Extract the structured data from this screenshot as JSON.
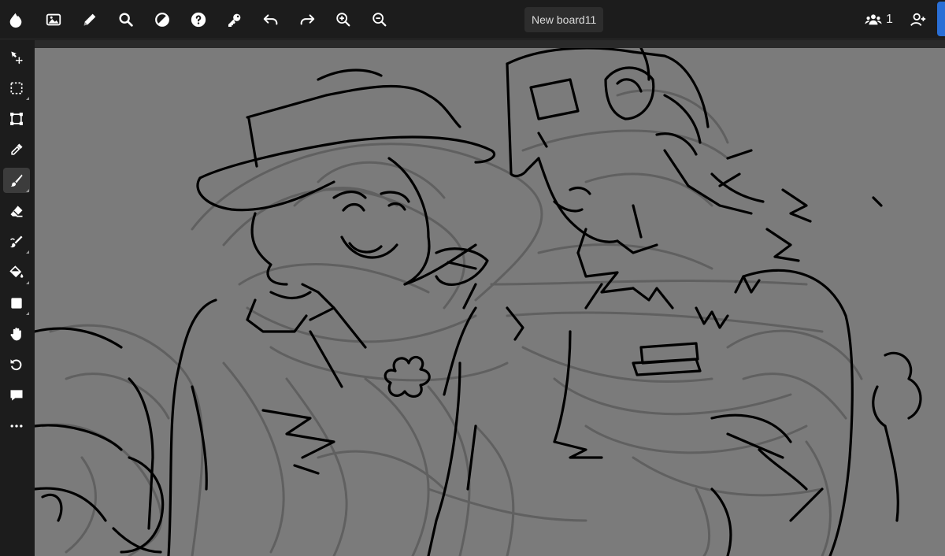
{
  "app": {
    "board_title": "New board11",
    "user_count": "1"
  },
  "toolbar": {
    "items": [
      {
        "name": "app-logo-icon",
        "icon": "drop-logo"
      },
      {
        "name": "image-icon",
        "icon": "image"
      },
      {
        "name": "pencil-icon",
        "icon": "pencil"
      },
      {
        "name": "search-icon",
        "icon": "search"
      },
      {
        "name": "contrast-icon",
        "icon": "half-circle"
      },
      {
        "name": "help-icon",
        "icon": "question-circle"
      },
      {
        "name": "key-icon",
        "icon": "key"
      },
      {
        "name": "undo-icon",
        "icon": "undo"
      },
      {
        "name": "redo-icon",
        "icon": "redo"
      },
      {
        "name": "zoom-in-icon",
        "icon": "zoom-in"
      },
      {
        "name": "zoom-out-icon",
        "icon": "zoom-out"
      }
    ]
  },
  "sidebar": {
    "tools": [
      {
        "name": "move-tool",
        "icon": "move-arrow",
        "active": false
      },
      {
        "name": "select-tool",
        "icon": "dashed-rect",
        "active": false
      },
      {
        "name": "transform-tool",
        "icon": "transform",
        "active": false
      },
      {
        "name": "eyedropper-tool",
        "icon": "eyedropper",
        "active": false
      },
      {
        "name": "brush-tool",
        "icon": "brush",
        "active": true
      },
      {
        "name": "eraser-tool",
        "icon": "eraser",
        "active": false
      },
      {
        "name": "smudge-tool",
        "icon": "smudge",
        "active": false
      },
      {
        "name": "fill-tool",
        "icon": "paint-bucket",
        "active": false
      },
      {
        "name": "shape-tool",
        "icon": "square",
        "active": false
      },
      {
        "name": "hand-tool",
        "icon": "hand",
        "active": false
      },
      {
        "name": "rotate-tool",
        "icon": "rotate",
        "active": false
      },
      {
        "name": "comment-tool",
        "icon": "speech-bubble",
        "active": false
      },
      {
        "name": "more-tools",
        "icon": "ellipsis",
        "active": false
      }
    ]
  },
  "colors": {
    "chrome": "#1c1c1c",
    "canvas_bg": "#7b7b7b",
    "accent": "#2a6fd6",
    "ink": "#000000"
  }
}
